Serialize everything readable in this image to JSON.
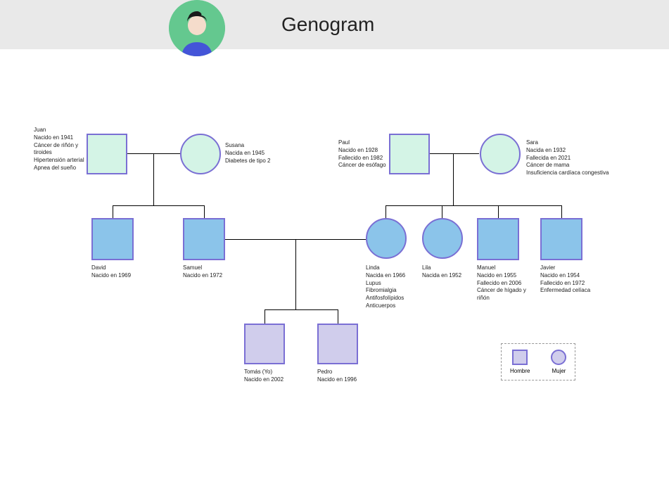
{
  "header": {
    "title": "Genogram"
  },
  "legend": {
    "male": "Hombre",
    "female": "Mujer"
  },
  "people": {
    "juan": {
      "name": "Juan",
      "lines": [
        "Nacido en 1941",
        "Cáncer de riñón y",
        "tiroides",
        "Hipertensión arterial",
        "Apnea del sueño"
      ]
    },
    "susana": {
      "name": "Susana",
      "lines": [
        "Nacida en 1945",
        "Diabetes de tipo 2"
      ]
    },
    "paul": {
      "name": "Paul",
      "lines": [
        "Nacido en 1928",
        "Fallecido en 1982",
        "Cáncer de esófago"
      ]
    },
    "sara": {
      "name": "Sara",
      "lines": [
        "Nacida en 1932",
        "Fallecida en 2021",
        "Cáncer de mama",
        "Insuficiencia cardíaca congestiva"
      ]
    },
    "david": {
      "name": "David",
      "lines": [
        "Nacido en 1969"
      ]
    },
    "samuel": {
      "name": "Samuel",
      "lines": [
        "Nacido en 1972"
      ]
    },
    "linda": {
      "name": "Linda",
      "lines": [
        "Nacida en 1966",
        "Lupus",
        "Fibromialgia",
        "Antifosfolípidos",
        "Anticuerpos"
      ]
    },
    "lila": {
      "name": "Lila",
      "lines": [
        "Nacida en 1952"
      ]
    },
    "manuel": {
      "name": "Manuel",
      "lines": [
        "Nacido en 1955",
        "Fallecido en 2006",
        "Cáncer de hígado y",
        "riñón"
      ]
    },
    "javier": {
      "name": "Javier",
      "lines": [
        "Nacido en 1954",
        "Fallecido en 1972",
        "Enfermedad celíaca"
      ]
    },
    "tomas": {
      "name": "Tomás (Yo)",
      "lines": [
        "Nacido en 2002"
      ]
    },
    "pedro": {
      "name": "Pedro",
      "lines": [
        "Nacido en 1996"
      ]
    }
  }
}
